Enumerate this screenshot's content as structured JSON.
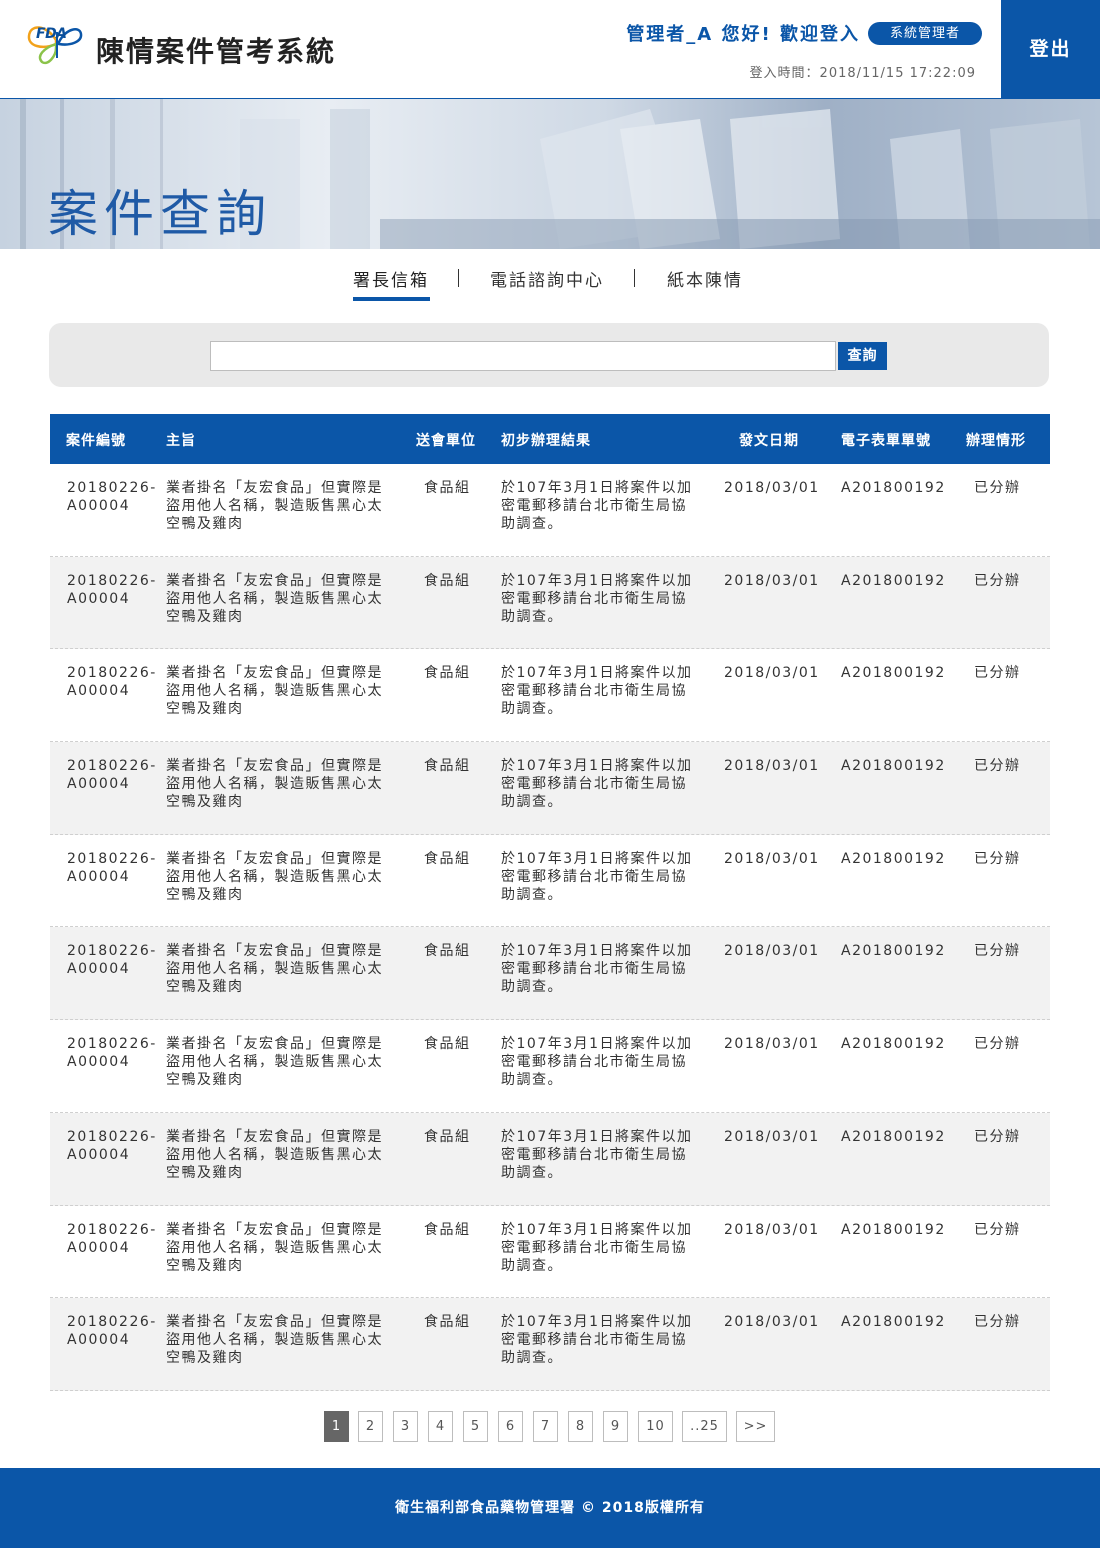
{
  "header": {
    "logo_text": "FDA",
    "app_title": "陳情案件管考系統",
    "greeting": "管理者_A 您好! 歡迎登入",
    "role_badge": "系統管理者",
    "login_time": "登入時間：2018/11/15 17:22:09",
    "logout_label": "登出"
  },
  "banner": {
    "page_title": "案件查詢"
  },
  "tabs": [
    {
      "label": "署長信箱",
      "active": true
    },
    {
      "label": "電話諮詢中心",
      "active": false
    },
    {
      "label": "紙本陳情",
      "active": false
    }
  ],
  "search": {
    "value": "",
    "placeholder": "",
    "button_label": "查詢"
  },
  "table": {
    "headers": [
      "案件編號",
      "主旨",
      "送會單位",
      "初步辦理結果",
      "發文日期",
      "電子表單單號",
      "辦理情形"
    ],
    "rows": [
      {
        "id": "20180226-A00004",
        "subject": "業者掛名「友宏食品」但實際是盜用他人名稱，製造販售黑心太空鴨及雞肉",
        "unit": "食品組",
        "result": "於107年3月1日將案件以加密電郵移請台北市衛生局協助調查。",
        "date": "2018/03/01",
        "form_no": "A201800192",
        "status": "已分辦"
      },
      {
        "id": "20180226-A00004",
        "subject": "業者掛名「友宏食品」但實際是盜用他人名稱，製造販售黑心太空鴨及雞肉",
        "unit": "食品組",
        "result": "於107年3月1日將案件以加密電郵移請台北市衛生局協助調查。",
        "date": "2018/03/01",
        "form_no": "A201800192",
        "status": "已分辦"
      },
      {
        "id": "20180226-A00004",
        "subject": "業者掛名「友宏食品」但實際是盜用他人名稱，製造販售黑心太空鴨及雞肉",
        "unit": "食品組",
        "result": "於107年3月1日將案件以加密電郵移請台北市衛生局協助調查。",
        "date": "2018/03/01",
        "form_no": "A201800192",
        "status": "已分辦"
      },
      {
        "id": "20180226-A00004",
        "subject": "業者掛名「友宏食品」但實際是盜用他人名稱，製造販售黑心太空鴨及雞肉",
        "unit": "食品組",
        "result": "於107年3月1日將案件以加密電郵移請台北市衛生局協助調查。",
        "date": "2018/03/01",
        "form_no": "A201800192",
        "status": "已分辦"
      },
      {
        "id": "20180226-A00004",
        "subject": "業者掛名「友宏食品」但實際是盜用他人名稱，製造販售黑心太空鴨及雞肉",
        "unit": "食品組",
        "result": "於107年3月1日將案件以加密電郵移請台北市衛生局協助調查。",
        "date": "2018/03/01",
        "form_no": "A201800192",
        "status": "已分辦"
      },
      {
        "id": "20180226-A00004",
        "subject": "業者掛名「友宏食品」但實際是盜用他人名稱，製造販售黑心太空鴨及雞肉",
        "unit": "食品組",
        "result": "於107年3月1日將案件以加密電郵移請台北市衛生局協助調查。",
        "date": "2018/03/01",
        "form_no": "A201800192",
        "status": "已分辦"
      },
      {
        "id": "20180226-A00004",
        "subject": "業者掛名「友宏食品」但實際是盜用他人名稱，製造販售黑心太空鴨及雞肉",
        "unit": "食品組",
        "result": "於107年3月1日將案件以加密電郵移請台北市衛生局協助調查。",
        "date": "2018/03/01",
        "form_no": "A201800192",
        "status": "已分辦"
      },
      {
        "id": "20180226-A00004",
        "subject": "業者掛名「友宏食品」但實際是盜用他人名稱，製造販售黑心太空鴨及雞肉",
        "unit": "食品組",
        "result": "於107年3月1日將案件以加密電郵移請台北市衛生局協助調查。",
        "date": "2018/03/01",
        "form_no": "A201800192",
        "status": "已分辦"
      },
      {
        "id": "20180226-A00004",
        "subject": "業者掛名「友宏食品」但實際是盜用他人名稱，製造販售黑心太空鴨及雞肉",
        "unit": "食品組",
        "result": "於107年3月1日將案件以加密電郵移請台北市衛生局協助調查。",
        "date": "2018/03/01",
        "form_no": "A201800192",
        "status": "已分辦"
      },
      {
        "id": "20180226-A00004",
        "subject": "業者掛名「友宏食品」但實際是盜用他人名稱，製造販售黑心太空鴨及雞肉",
        "unit": "食品組",
        "result": "於107年3月1日將案件以加密電郵移請台北市衛生局協助調查。",
        "date": "2018/03/01",
        "form_no": "A201800192",
        "status": "已分辦"
      }
    ]
  },
  "pagination": {
    "pages": [
      "1",
      "2",
      "3",
      "4",
      "5",
      "6",
      "7",
      "8",
      "9",
      "10",
      "..25",
      ">>"
    ],
    "current": "1"
  },
  "footer": {
    "copyright": "衛生福利部食品藥物管理署 © 2018版權所有"
  },
  "colors": {
    "brand_blue": "#0b56a8",
    "row_alt": "#f2f2f2",
    "search_bg": "#e9e9e9",
    "page_current": "#666666"
  }
}
